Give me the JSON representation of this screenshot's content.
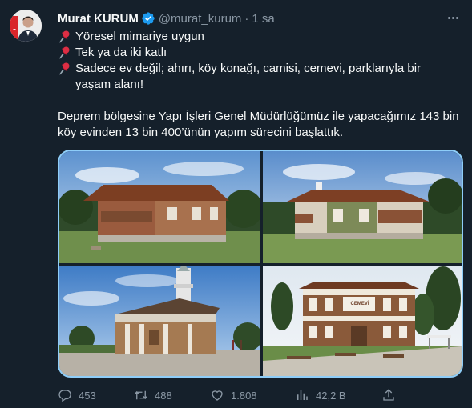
{
  "author": {
    "name": "Murat KURUM",
    "handle": "@murat_kurum",
    "separator": "·",
    "time": "1 sa"
  },
  "tweet": {
    "lines": [
      "Yöresel mimariye uygun",
      "Tek ya da iki katlı",
      "Sadece ev değil; ahırı, köy konağı, camisi, cemevi, parklarıyla bir yaşam alanı!"
    ],
    "paragraph": "Deprem bölgesine Yapı İşleri Genel Müdürlüğümüz ile yapacağımız 143 bin köy evinden 13 bin 400’ünün yapım sürecini başlattık."
  },
  "media": {
    "images": [
      {
        "subject": "single-storey village house with wooden porch"
      },
      {
        "subject": "village house with green walls and chimney"
      },
      {
        "subject": "mosque with minaret"
      },
      {
        "subject": "two-storey cemevi building with courtyard"
      }
    ],
    "sign_text": "CEMEVİ"
  },
  "metrics": {
    "replies": "453",
    "retweets": "488",
    "likes": "1.808",
    "views": "42,2 B"
  },
  "colors": {
    "background": "#15202b",
    "text": "#f7f9f9",
    "muted": "#8b98a5",
    "verified": "#1d9bf0",
    "media_border": "#8ecdf8"
  },
  "icons": [
    "pushpin-icon",
    "verified-badge-icon",
    "more-icon",
    "reply-icon",
    "retweet-icon",
    "like-icon",
    "views-icon",
    "share-icon"
  ]
}
